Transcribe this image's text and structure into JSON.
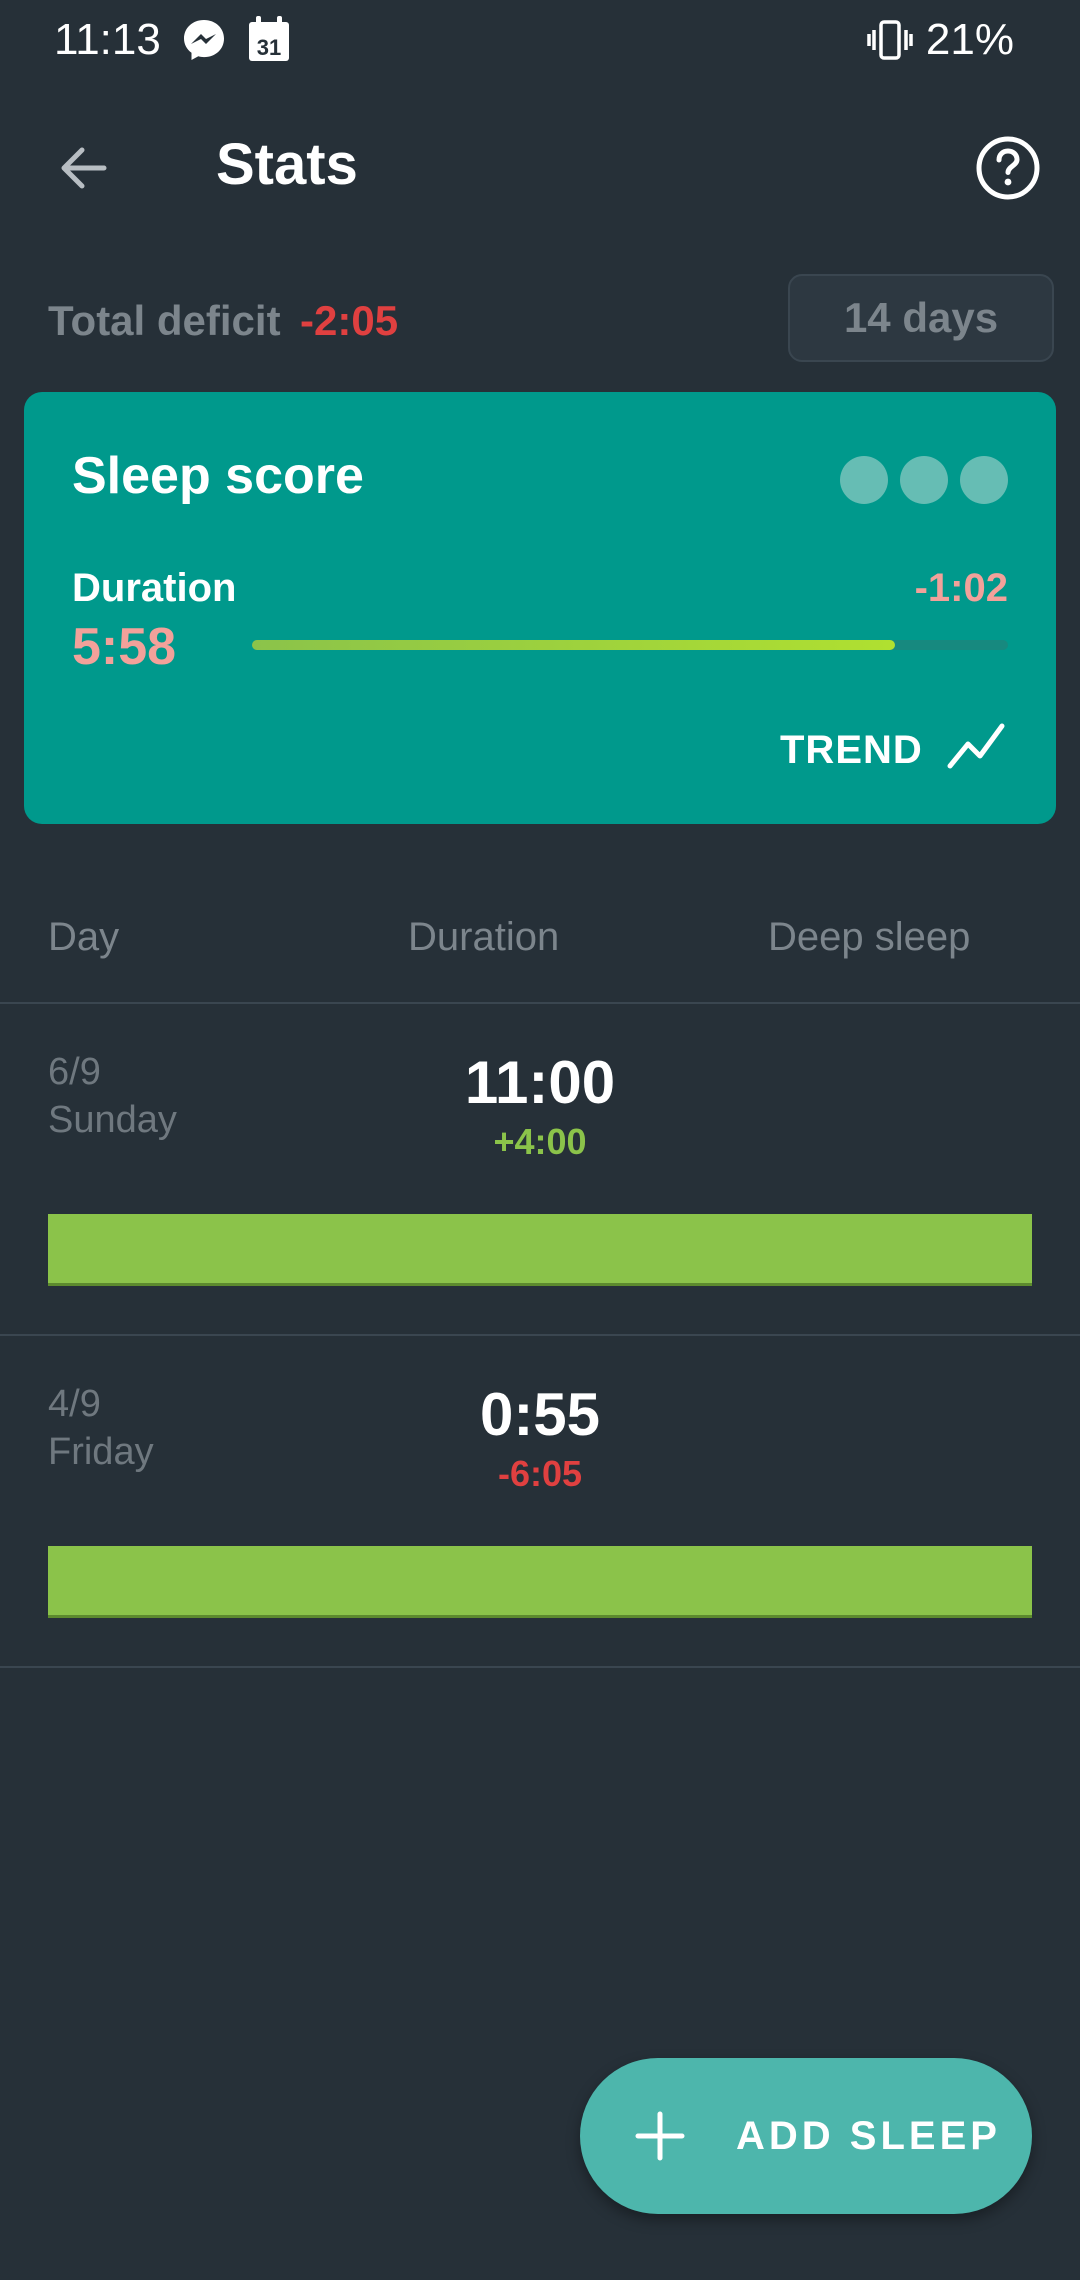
{
  "status_bar": {
    "time": "11:13",
    "battery": "21%",
    "icons": [
      "messenger-icon",
      "calendar-icon",
      "vibrate-icon"
    ],
    "calendar_day": "31"
  },
  "app_bar": {
    "title": "Stats",
    "icons": [
      "back-arrow-icon",
      "help-icon"
    ]
  },
  "summary": {
    "deficit_label": "Total deficit",
    "deficit_value": "-2:05",
    "range_button": "14 days"
  },
  "sleep_score_card": {
    "title": "Sleep score",
    "duration_label": "Duration",
    "duration_value": "5:58",
    "duration_delta": "-1:02",
    "duration_progress": 0.85,
    "trend_label": "TREND",
    "colors": {
      "card": "#00998c",
      "bar": "#8bc34a",
      "value": "#f2a19a"
    }
  },
  "table": {
    "columns": [
      "Day",
      "Duration",
      "Deep sleep"
    ],
    "rows": [
      {
        "date": "6/9",
        "weekday": "Sunday",
        "duration": "11:00",
        "delta": "+4:00",
        "delta_color": "#8bc34a"
      },
      {
        "date": "4/9",
        "weekday": "Friday",
        "duration": "0:55",
        "delta": "-6:05",
        "delta_color": "#e04040"
      }
    ]
  },
  "fab": {
    "label": "ADD SLEEP",
    "icon": "plus-icon"
  }
}
